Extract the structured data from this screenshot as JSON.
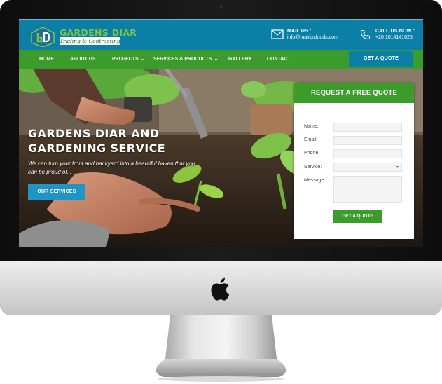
{
  "site": {
    "logo": {
      "title": "GARDENS DIAR",
      "subtitle": "Trading & Contracting"
    },
    "contact": {
      "mail_label": "MAIL US :",
      "mail_value": "info@matrixclouds.com",
      "call_label": "CALL US NOW :",
      "call_value": "+20 1014141625"
    },
    "nav": {
      "items": [
        {
          "label": "HOME"
        },
        {
          "label": "ABOUT US"
        },
        {
          "label": "PROJECTS",
          "caret": "⌄"
        },
        {
          "label": "SERVICES & PRODUCTS",
          "caret": "⌄"
        },
        {
          "label": "GALLERY"
        },
        {
          "label": "CONTACT"
        }
      ],
      "quote_button": "GET A QUOTE"
    },
    "hero": {
      "title": "GARDENS DIAR AND GARDENING SERVICE",
      "subtitle": "We can turn your front and backyard into a beautiful haven that you can be proud of. .",
      "button": "OUR SERVICES"
    },
    "form": {
      "heading": "REQUEST A FREE QUOTE",
      "fields": [
        {
          "label": "Name:"
        },
        {
          "label": "Email:"
        },
        {
          "label": "Phone:"
        },
        {
          "label": "Service:"
        },
        {
          "label": "Message:"
        }
      ],
      "select_arrow": "▾",
      "submit": "GET A QUOTE"
    }
  },
  "icons": [
    "envelope-icon",
    "phone-icon",
    "apple-logo-icon",
    "gardens-diar-logo-icon"
  ],
  "colors": {
    "header_blue": "#0c7fa6",
    "nav_green": "#3b9c2b",
    "button_blue": "#1e95c4",
    "logo_green": "#7ec443"
  }
}
